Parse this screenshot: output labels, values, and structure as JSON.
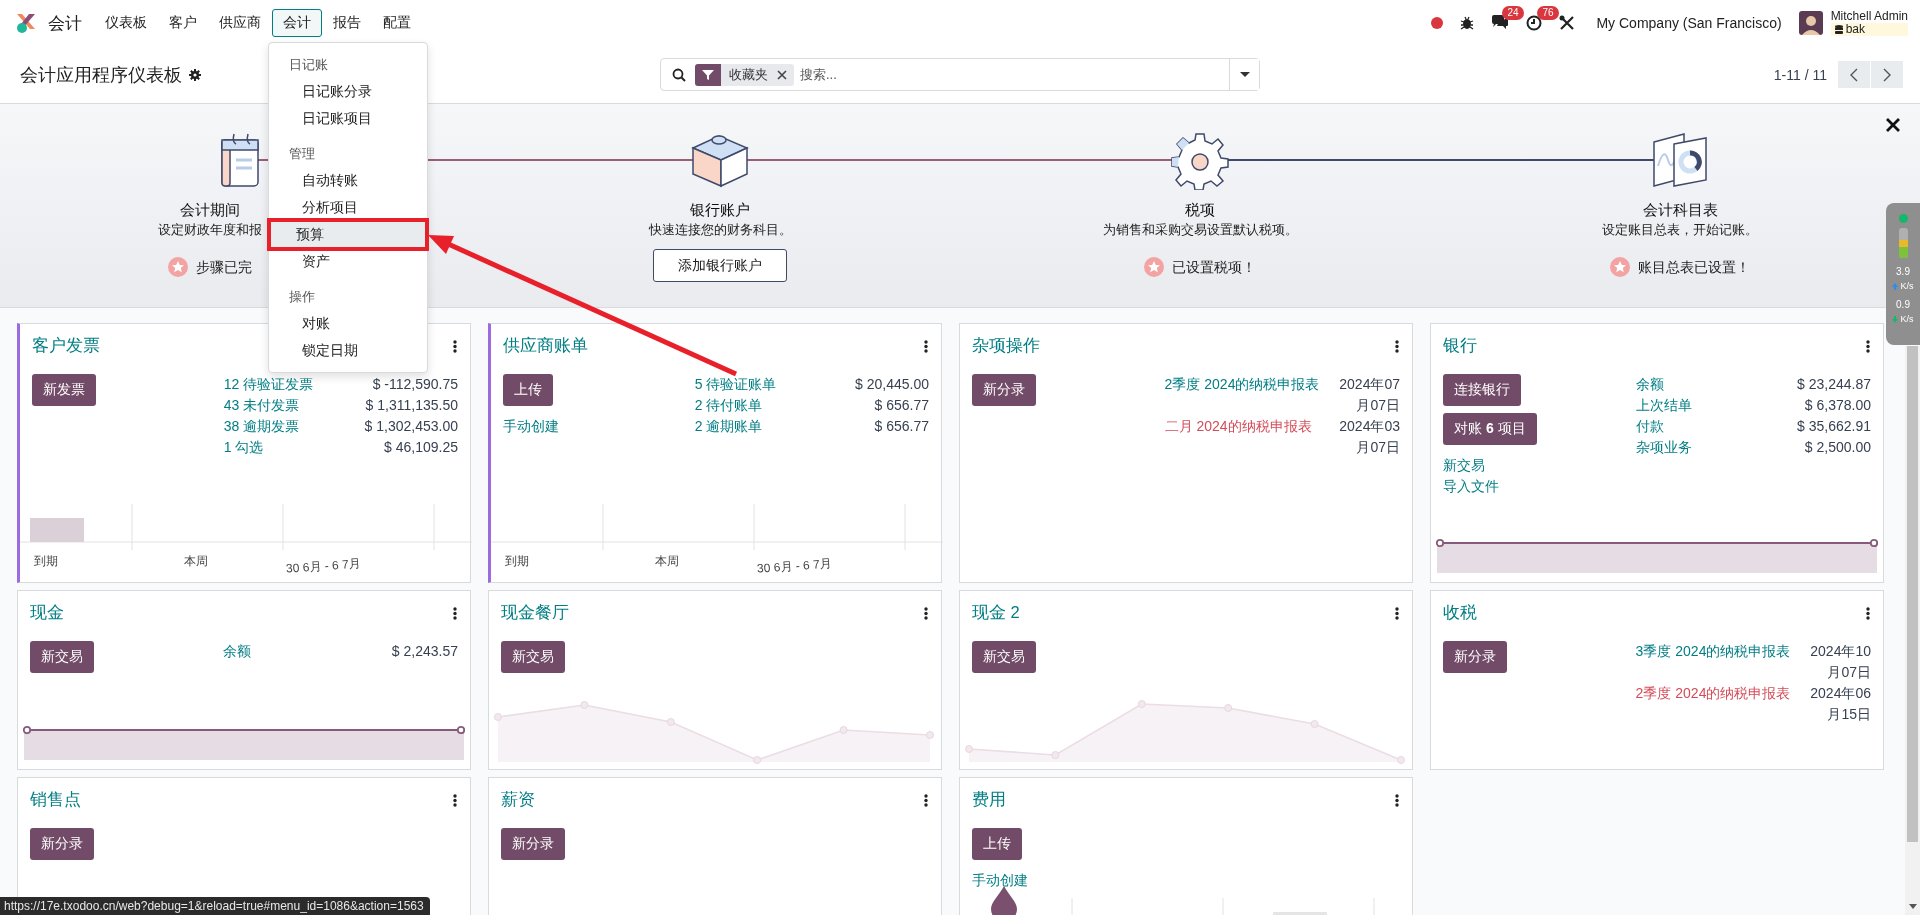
{
  "navbar": {
    "app_name": "会计",
    "menu": [
      {
        "label": "仪表板",
        "selected": false
      },
      {
        "label": "客户",
        "selected": false
      },
      {
        "label": "供应商",
        "selected": false
      },
      {
        "label": "会计",
        "selected": true
      },
      {
        "label": "报告",
        "selected": false
      },
      {
        "label": "配置",
        "selected": false
      }
    ]
  },
  "systray": {
    "chat_count": "24",
    "activity_count": "76",
    "company": "My Company (San Francisco)",
    "user_name": "Mitchell Admin",
    "database": "bak"
  },
  "dropdown_menu": {
    "sections": [
      {
        "header": "日记账",
        "items": [
          {
            "label": "日记账分录",
            "selected": false
          },
          {
            "label": "日记账项目",
            "selected": false
          }
        ]
      },
      {
        "header": "管理",
        "items": [
          {
            "label": "自动转账",
            "selected": false
          },
          {
            "label": "分析项目",
            "selected": false
          },
          {
            "label": "预算",
            "selected": true
          },
          {
            "label": "资产",
            "selected": false
          }
        ]
      },
      {
        "header": "操作",
        "items": [
          {
            "label": "对账",
            "selected": false
          },
          {
            "label": "锁定日期",
            "selected": false
          }
        ]
      }
    ]
  },
  "control_panel": {
    "breadcrumb": "会计应用程序仪表板",
    "search": {
      "facet": "收藏夹",
      "placeholder": "搜索..."
    },
    "pager": "1-11 / 11"
  },
  "onboarding": {
    "steps": [
      {
        "title": "会计期间",
        "description": "设定财政年度和报",
        "done": true,
        "status": "步骤已完"
      },
      {
        "title": "银行账户",
        "description": "快速连接您的财务科目。",
        "done": false,
        "action": "添加银行账户"
      },
      {
        "title": "税项",
        "description": "为销售和采购交易设置默认税项。",
        "done": true,
        "status": "已设置税项！"
      },
      {
        "title": "会计科目表",
        "description": "设定账目总表，开始记账。",
        "done": true,
        "status": "账目总表已设置！"
      }
    ]
  },
  "dashboard": {
    "cards": [
      {
        "title": "客户发票",
        "accent": true,
        "buttons": [
          "新发票"
        ],
        "rows": [
          {
            "label": "12 待验证发票",
            "value": "$ -112,590.75"
          },
          {
            "label": "43 未付发票",
            "value": "$ 1,311,135.50"
          },
          {
            "label": "38 逾期发票",
            "value": "$ 1,302,453.00"
          },
          {
            "label": "1 勾选",
            "value": "$ 46,109.25"
          }
        ],
        "graph": {
          "kind": "bar",
          "labels": [
            "到期",
            "本周",
            "30 6月 - 6 7月"
          ]
        }
      },
      {
        "title": "供应商账单",
        "accent": true,
        "buttons": [
          "上传"
        ],
        "links": [
          "手动创建"
        ],
        "rows": [
          {
            "label": "5 待验证账单",
            "value": "$ 20,445.00"
          },
          {
            "label": "2 待付账单",
            "value": "$ 656.77"
          },
          {
            "label": "2 逾期账单",
            "value": "$ 656.77"
          }
        ],
        "graph": {
          "kind": "bar",
          "labels": [
            "到期",
            "本周",
            "30 6月 - 6 7月"
          ]
        }
      },
      {
        "title": "杂项操作",
        "accent": false,
        "buttons": [
          "新分录"
        ],
        "rows": [
          {
            "label": "2季度 2024的纳税申报表",
            "date": "2024年07月07日",
            "late": false
          },
          {
            "label": "二月 2024的纳税申报表",
            "date": "2024年03月07日",
            "late": true
          }
        ]
      },
      {
        "title": "银行",
        "accent": false,
        "buttons": [
          "连接银行",
          "对账 **6** 项目"
        ],
        "links": [
          "新交易",
          "导入文件"
        ],
        "rows": [
          {
            "label": "余额",
            "value": "$ 23,244.87"
          },
          {
            "label": "上次结单",
            "value": "$ 6,378.00"
          },
          {
            "label": "付款",
            "value": "$ 35,662.91"
          },
          {
            "label": "杂项业务",
            "value": "$ 2,500.00"
          }
        ],
        "graph": {
          "kind": "flat"
        }
      },
      {
        "title": "现金",
        "accent": false,
        "buttons": [
          "新交易"
        ],
        "rows": [
          {
            "label": "余额",
            "value": "$ 2,243.57"
          }
        ],
        "graph": {
          "kind": "flat"
        }
      },
      {
        "title": "现金餐厅",
        "accent": false,
        "buttons": [
          "新交易"
        ],
        "graph": {
          "kind": "trend"
        }
      },
      {
        "title": "现金 2",
        "accent": false,
        "buttons": [
          "新交易"
        ],
        "graph": {
          "kind": "trend"
        }
      },
      {
        "title": "收税",
        "accent": false,
        "buttons": [
          "新分录"
        ],
        "rows": [
          {
            "label": "3季度 2024的纳税申报表",
            "date": "2024年10月07日",
            "late": false
          },
          {
            "label": "2季度 2024的纳税申报表",
            "date": "2024年06月15日",
            "late": true
          }
        ]
      },
      {
        "title": "销售点",
        "accent": false,
        "buttons": [
          "新分录"
        ]
      },
      {
        "title": "薪资",
        "accent": false,
        "buttons": [
          "新分录"
        ]
      },
      {
        "title": "费用",
        "accent": false,
        "buttons": [
          "上传"
        ],
        "links": [
          "手动创建"
        ],
        "graph": {
          "kind": "bar"
        }
      }
    ]
  },
  "network_widget": {
    "upload": "3.9",
    "upload_unit": "K/s",
    "download": "0.9",
    "download_unit": "K/s"
  },
  "status_url": "https://17e.txodoo.cn/web?debug=1&reload=true#menu_id=1086&action=1563"
}
